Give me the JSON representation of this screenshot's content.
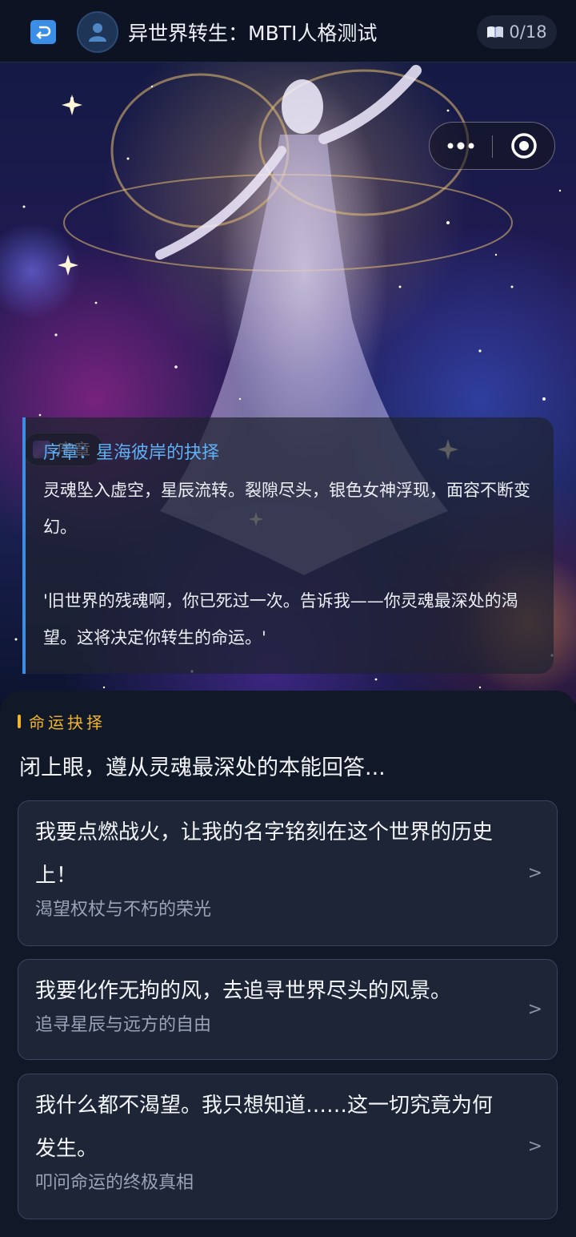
{
  "header": {
    "title": "异世界转生：MBTI人格测试",
    "progress": "0/18",
    "progress_icon": "book-icon"
  },
  "hero": {
    "chapter_tag": "序章",
    "story": {
      "title": "序章：星海彼岸的抉择",
      "paragraph1": "灵魂坠入虚空，星辰流转。裂隙尽头，银色女神浮现，面容不断变幻。",
      "paragraph2": "'旧世界的残魂啊，你已死过一次。告诉我——你灵魂最深处的渴望。这将决定你转生的命运。'"
    }
  },
  "choice": {
    "section_label": "命运抉择",
    "prompt": "闭上眼，遵从灵魂最深处的本能回答...",
    "options": [
      {
        "text": "我要点燃战火，让我的名字铭刻在这个世界的历史上！",
        "subtitle": "渴望权杖与不朽的荣光"
      },
      {
        "text": "我要化作无拘的风，去追寻世界尽头的风景。",
        "subtitle": "追寻星辰与远方的自由"
      },
      {
        "text": "我什么都不渴望。我只想知道……这一切究竟为何发生。",
        "subtitle": "叩问命运的终极真相"
      }
    ],
    "chevron": ">"
  },
  "colors": {
    "accent_blue": "#3a8ee6",
    "accent_gold": "#f0b429",
    "panel_bg": "#111827",
    "card_bg": "#1d2537"
  }
}
